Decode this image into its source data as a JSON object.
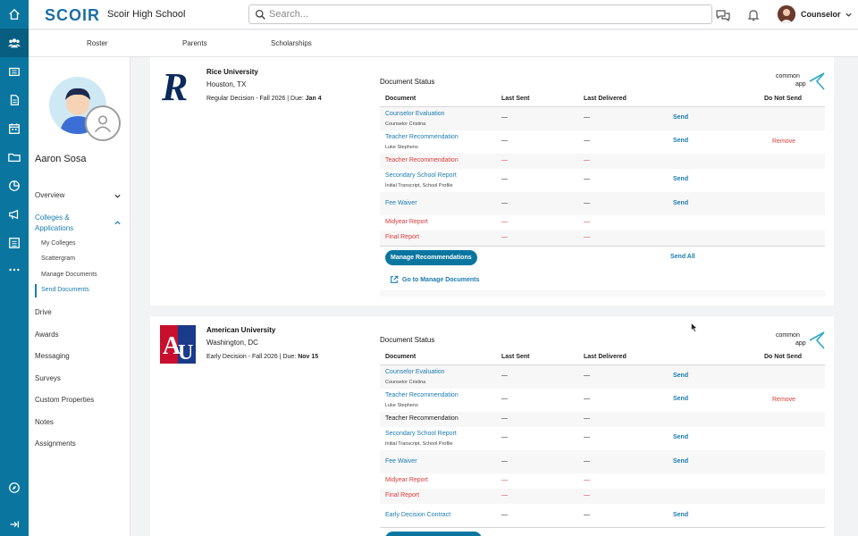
{
  "app": {
    "logo": "SCOIR",
    "school": "Scoir High School",
    "search_placeholder": "Search...",
    "user_role": "Counselor"
  },
  "subnav": {
    "tabs": [
      "Roster",
      "Parents",
      "Scholarships"
    ]
  },
  "student": {
    "name": "Aaron Sosa"
  },
  "sidebar": {
    "overview": "Overview",
    "colleges": "Colleges &",
    "colleges_line2": "Applications",
    "sub": [
      "My Colleges",
      "Scattergram",
      "Manage Documents",
      "Send Documents"
    ],
    "items": [
      "Drive",
      "Awards",
      "Messaging",
      "Surveys",
      "Custom Properties",
      "Notes",
      "Assignments"
    ]
  },
  "colors": {
    "brand": "#0a76a0",
    "link": "#1a7bb0",
    "alert": "#d83a3a"
  },
  "headers": {
    "section": "Document Status",
    "document": "Document",
    "last_sent": "Last Sent",
    "last_delivered": "Last Delivered",
    "do_not_send": "Do Not Send"
  },
  "common_app": {
    "line1": "common",
    "line2": "app"
  },
  "dash": "—",
  "send_label": "Send",
  "remove_label": "Remove",
  "colleges": [
    {
      "name": "Rice University",
      "location": "Houston, TX",
      "deadline_prefix": "Regular Decision - Fall 2026 | Due: ",
      "deadline_date": "Jan 4",
      "seal_letter": "R",
      "docs": [
        {
          "name": "Counselor Evaluation",
          "sub": "Counselor Cristina"
        },
        {
          "name": "Teacher Recommendation",
          "sub": "Luke Stephens"
        },
        {
          "name": "Teacher Recommendation",
          "sub": ""
        },
        {
          "name": "Secondary School Report",
          "sub": "Initial Transcript, School Profile"
        },
        {
          "name": "Fee Waiver",
          "sub": ""
        },
        {
          "name": "Midyear Report",
          "sub": ""
        },
        {
          "name": "Final Report",
          "sub": ""
        }
      ],
      "manage_button": "Manage Recommendations",
      "send_all": "Send All",
      "go_link": "Go to Manage Documents"
    },
    {
      "name": "American University",
      "location": "Washington, DC",
      "deadline_prefix": "Early Decision - Fall 2026 | Due: ",
      "deadline_date": "Nov 15",
      "seal_letter": "AU",
      "docs": [
        {
          "name": "Counselor Evaluation",
          "sub": "Counselor Cristina"
        },
        {
          "name": "Teacher Recommendation",
          "sub": "Luke Stephens"
        },
        {
          "name": "Teacher Recommendation",
          "sub": ""
        },
        {
          "name": "Secondary School Report",
          "sub": "Initial Transcript, School Profile"
        },
        {
          "name": "Fee Waiver",
          "sub": ""
        },
        {
          "name": "Midyear Report",
          "sub": ""
        },
        {
          "name": "Final Report",
          "sub": ""
        },
        {
          "name": "Early Decision Contract",
          "sub": ""
        }
      ]
    }
  ]
}
